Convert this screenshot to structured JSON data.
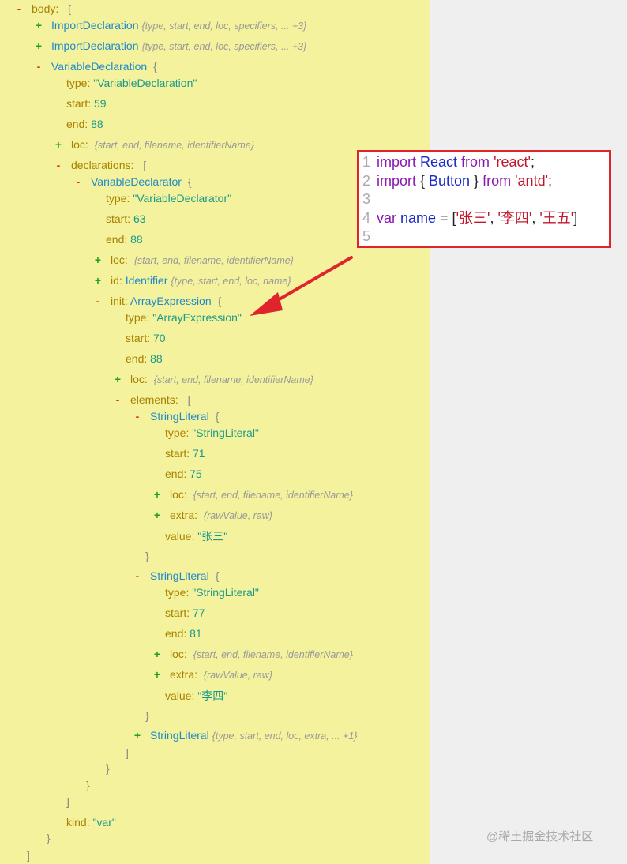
{
  "lines": [
    {
      "indent": 18,
      "toggle": "-",
      "key": "body",
      "sep": ": ",
      "bracket": "["
    },
    {
      "indent": 43,
      "toggle": "+",
      "type": "ImportDeclaration",
      "summary": "{type, start, end, loc, specifiers, ... +3}"
    },
    {
      "indent": 43,
      "toggle": "+",
      "type": "ImportDeclaration",
      "summary": "{type, start, end, loc, specifiers, ... +3}"
    },
    {
      "indent": 43,
      "toggle": "-",
      "type": "VariableDeclaration",
      "bracket": "{"
    },
    {
      "indent": 84,
      "key": "type",
      "sep": ": ",
      "str": "\"VariableDeclaration\""
    },
    {
      "indent": 84,
      "key": "start",
      "sep": ": ",
      "num": "59"
    },
    {
      "indent": 84,
      "key": "end",
      "sep": ": ",
      "num": "88"
    },
    {
      "indent": 68,
      "toggle": "+",
      "key": "loc",
      "sep": ": ",
      "summary": "{start, end, filename, identifierName}"
    },
    {
      "indent": 68,
      "toggle": "-",
      "key": "declarations",
      "sep": ": ",
      "bracket": "["
    },
    {
      "indent": 93,
      "toggle": "-",
      "type": "VariableDeclarator",
      "bracket": "{"
    },
    {
      "indent": 134,
      "key": "type",
      "sep": ": ",
      "str": "\"VariableDeclarator\""
    },
    {
      "indent": 134,
      "key": "start",
      "sep": ": ",
      "num": "63"
    },
    {
      "indent": 134,
      "key": "end",
      "sep": ": ",
      "num": "88"
    },
    {
      "indent": 118,
      "toggle": "+",
      "key": "loc",
      "sep": ": ",
      "summary": "{start, end, filename, identifierName}"
    },
    {
      "indent": 118,
      "toggle": "+",
      "key": "id",
      "sep": ": ",
      "type": "Identifier",
      "summary": "{type, start, end, loc, name}"
    },
    {
      "indent": 118,
      "toggle": "-",
      "key": "init",
      "sep": ": ",
      "type": "ArrayExpression",
      "bracket": "{"
    },
    {
      "indent": 159,
      "key": "type",
      "sep": ": ",
      "str": "\"ArrayExpression\""
    },
    {
      "indent": 159,
      "key": "start",
      "sep": ": ",
      "num": "70"
    },
    {
      "indent": 159,
      "key": "end",
      "sep": ": ",
      "num": "88"
    },
    {
      "indent": 143,
      "toggle": "+",
      "key": "loc",
      "sep": ": ",
      "summary": "{start, end, filename, identifierName}"
    },
    {
      "indent": 143,
      "toggle": "-",
      "key": "elements",
      "sep": ": ",
      "bracket": "["
    },
    {
      "indent": 168,
      "toggle": "-",
      "type": "StringLiteral",
      "bracket": "{"
    },
    {
      "indent": 209,
      "key": "type",
      "sep": ": ",
      "str": "\"StringLiteral\""
    },
    {
      "indent": 209,
      "key": "start",
      "sep": ": ",
      "num": "71"
    },
    {
      "indent": 209,
      "key": "end",
      "sep": ": ",
      "num": "75"
    },
    {
      "indent": 193,
      "toggle": "+",
      "key": "loc",
      "sep": ": ",
      "summary": "{start, end, filename, identifierName}"
    },
    {
      "indent": 193,
      "toggle": "+",
      "key": "extra",
      "sep": ": ",
      "summary": "{rawValue, raw}"
    },
    {
      "indent": 209,
      "key": "value",
      "sep": ": ",
      "str": "\"张三\""
    },
    {
      "indent": 184,
      "bracket": "}"
    },
    {
      "indent": 168,
      "toggle": "-",
      "type": "StringLiteral",
      "bracket": "{"
    },
    {
      "indent": 209,
      "key": "type",
      "sep": ": ",
      "str": "\"StringLiteral\""
    },
    {
      "indent": 209,
      "key": "start",
      "sep": ": ",
      "num": "77"
    },
    {
      "indent": 209,
      "key": "end",
      "sep": ": ",
      "num": "81"
    },
    {
      "indent": 193,
      "toggle": "+",
      "key": "loc",
      "sep": ": ",
      "summary": "{start, end, filename, identifierName}"
    },
    {
      "indent": 193,
      "toggle": "+",
      "key": "extra",
      "sep": ": ",
      "summary": "{rawValue, raw}"
    },
    {
      "indent": 209,
      "key": "value",
      "sep": ": ",
      "str": "\"李四\""
    },
    {
      "indent": 184,
      "bracket": "}"
    },
    {
      "indent": 168,
      "toggle": "+",
      "type": "StringLiteral",
      "summary": "{type, start, end, loc, extra, ... +1}"
    },
    {
      "indent": 159,
      "bracket": "]"
    },
    {
      "indent": 134,
      "bracket": "}"
    },
    {
      "indent": 109,
      "bracket": "}"
    },
    {
      "indent": 84,
      "bracket": "]"
    },
    {
      "indent": 84,
      "key": "kind",
      "sep": ": ",
      "str": "\"var\""
    },
    {
      "indent": 59,
      "bracket": "}"
    },
    {
      "indent": 34,
      "bracket": "]"
    }
  ],
  "line_tops": [
    0,
    21,
    47,
    73,
    94,
    120,
    146,
    172,
    198,
    219,
    240,
    266,
    292,
    318,
    344,
    370,
    391,
    417,
    443,
    469,
    495,
    516,
    537,
    563,
    589,
    615,
    641,
    668,
    693,
    718,
    739,
    765,
    791,
    817,
    843,
    870,
    895,
    920,
    942,
    962,
    983,
    1004,
    1030,
    1050,
    1072
  ],
  "code": [
    {
      "n": "1",
      "tokens": [
        {
          "c": "kw",
          "t": "import "
        },
        {
          "c": "id",
          "t": "React "
        },
        {
          "c": "kw",
          "t": "from "
        },
        {
          "c": "str",
          "t": "'react'"
        },
        {
          "c": "punc",
          "t": ";"
        }
      ]
    },
    {
      "n": "2",
      "tokens": [
        {
          "c": "kw",
          "t": "import "
        },
        {
          "c": "punc",
          "t": "{ "
        },
        {
          "c": "id",
          "t": "Button"
        },
        {
          "c": "punc",
          "t": " } "
        },
        {
          "c": "kw",
          "t": "from "
        },
        {
          "c": "str",
          "t": "'antd'"
        },
        {
          "c": "punc",
          "t": ";"
        }
      ]
    },
    {
      "n": "3",
      "tokens": []
    },
    {
      "n": "4",
      "tokens": [
        {
          "c": "kw",
          "t": "var "
        },
        {
          "c": "id",
          "t": "name"
        },
        {
          "c": "punc",
          "t": " = ["
        },
        {
          "c": "str",
          "t": "'张三'"
        },
        {
          "c": "punc",
          "t": ", "
        },
        {
          "c": "str",
          "t": "'李四'"
        },
        {
          "c": "punc",
          "t": ", "
        },
        {
          "c": "str",
          "t": "'王五'"
        },
        {
          "c": "punc",
          "t": "]"
        }
      ]
    },
    {
      "n": "5",
      "tokens": []
    }
  ],
  "watermark": "@稀土掘金技术社区",
  "colors": {
    "panel": "#f4f29d",
    "background": "#efefef",
    "highlight": "#e0242c"
  }
}
